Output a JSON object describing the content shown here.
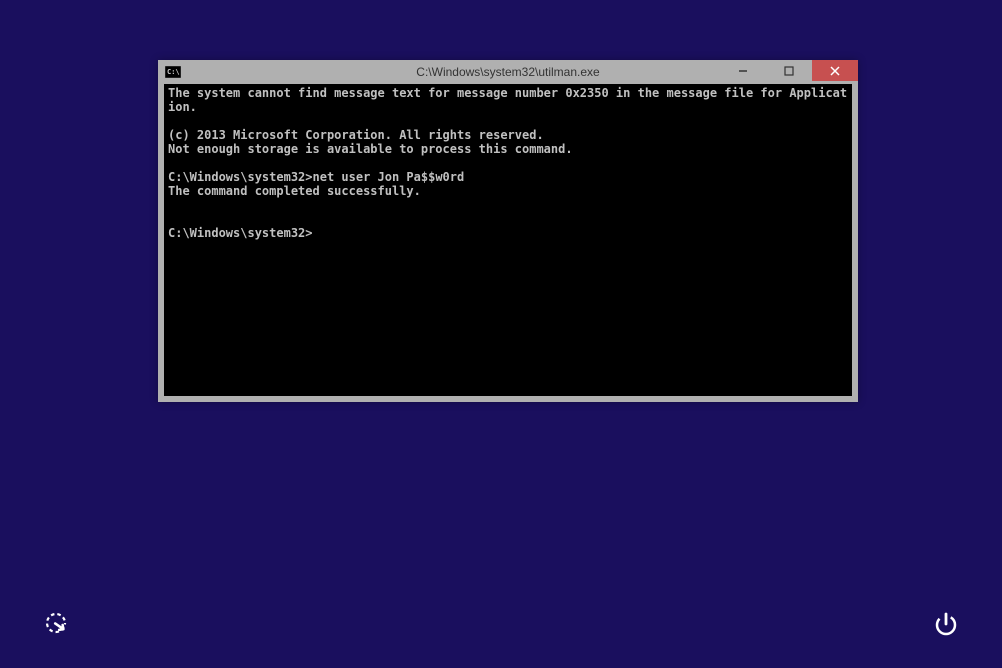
{
  "window": {
    "title": "C:\\Windows\\system32\\utilman.exe",
    "icon_name": "cmd-icon"
  },
  "terminal": {
    "line1": "The system cannot find message text for message number 0x2350 in the message file for Application.",
    "line2": "",
    "line3": "(c) 2013 Microsoft Corporation. All rights reserved.",
    "line4": "Not enough storage is available to process this command.",
    "line5": "",
    "prompt1": "C:\\Windows\\system32>",
    "command1": "net user Jon Pa$$w0rd",
    "result1": "The command completed successfully.",
    "line6": "",
    "line7": "",
    "prompt2": "C:\\Windows\\system32>"
  },
  "buttons": {
    "minimize": "minimize",
    "maximize": "maximize",
    "close": "close",
    "ease_of_access": "ease-of-access",
    "power": "power"
  }
}
